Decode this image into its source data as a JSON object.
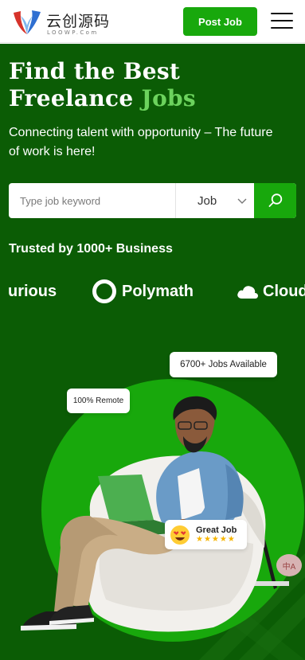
{
  "header": {
    "logo_text": "云创源码",
    "logo_subtext": "LOOWP.Com",
    "post_job_label": "Post Job"
  },
  "hero": {
    "title_line1": "Find the Best",
    "title_line2_plain": "Freelance",
    "title_line2_accent": "Jobs",
    "subtitle": "Connecting talent with opportunity – The future of work is here!",
    "search": {
      "placeholder": "Type job keyword",
      "category_value": "Job"
    },
    "trusted_label": "Trusted by 1000+ Business",
    "brands": [
      "urious",
      "Polymath",
      "Cloud"
    ],
    "badges": {
      "jobs_available": "6700+ Jobs Available",
      "remote": "100% Remote",
      "great_job": "Great Job",
      "rating_stars": "★★★★★"
    },
    "translate_label": "中A"
  },
  "colors": {
    "brand_green": "#18a80c",
    "hero_bg": "#0b5c05",
    "accent_text": "#6cd35d",
    "star": "#f7b500"
  }
}
